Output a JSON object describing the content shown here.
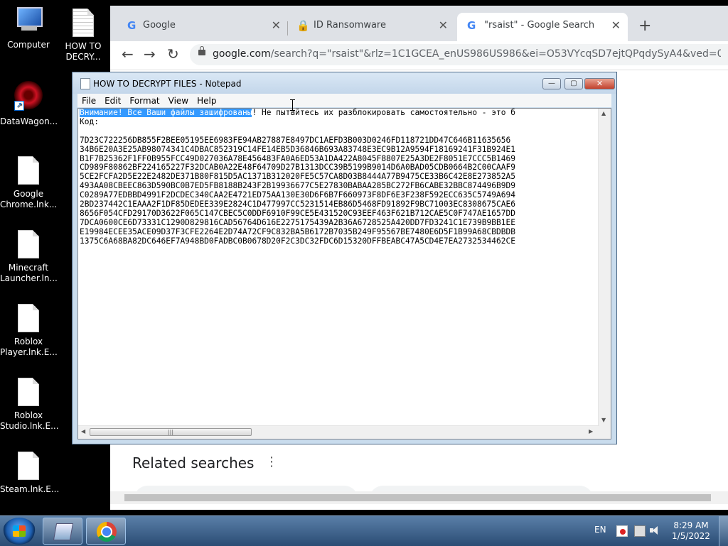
{
  "desktop": {
    "icons": [
      {
        "label": "Computer",
        "icon": "computer-icon"
      },
      {
        "label": "HOW TO\nDECRY...",
        "icon": "text-file-icon"
      },
      {
        "label": "DataWagon...",
        "icon": "datawagon-icon"
      },
      {
        "label": "Google\nChrome.lnk...",
        "icon": "file-icon"
      },
      {
        "label": "Minecraft\nLauncher.ln...",
        "icon": "file-icon"
      },
      {
        "label": "Roblox\nPlayer.lnk.E...",
        "icon": "file-icon"
      },
      {
        "label": "Roblox\nStudio.lnk.E...",
        "icon": "file-icon"
      },
      {
        "label": "Steam.lnk.E...",
        "icon": "file-icon"
      }
    ]
  },
  "browser": {
    "tabs": [
      {
        "title": "Google",
        "icon": "google-icon"
      },
      {
        "title": "ID Ransomware",
        "icon": "google-icon"
      },
      {
        "title": "\"rsaist\" - Google Search",
        "icon": "google-icon",
        "active": true
      }
    ],
    "new_tab": "+",
    "url_host": "google.com",
    "url_path": "/search?q=\"rsaist\"&rlz=1C1GCEA_enUS986US986&ei=O53VYcqSD7ejtQPqdySyA4&ved=0ahUKEwiK...",
    "related_searches": "Related searches"
  },
  "notepad": {
    "title": "HOW TO DECRYPT FILES - Notepad",
    "menu": [
      "File",
      "Edit",
      "Format",
      "View",
      "Help"
    ],
    "controls": {
      "minimize": "—",
      "maximize": "▢",
      "close": "✕"
    },
    "line1_selected": "Внимание! Все Ваши файлы зашифрованы",
    "line1_rest": "! Не пытайтесь их разблокировать самостоятельно - это б",
    "line2": "Код:",
    "code_lines": [
      "7D23C722256DB855F2BEE05195EE6983FE94AB27887E8497DC1AEFD3B003D0246FD118721DD47C646B11635656",
      "34B6E20A3E25AB98074341C4DBAC852319C14FE14EB5D36846B693A83748E3EC9B12A9594F18169241F31B924E1",
      "B1F7B25362F1FF0B955FCC49D027036A78E456483FA0A6ED53A1DA422A8045F8807E25A3DE2F8051E7CCC5B1469",
      "CD989F80862BF224165227F32DCAB0A22E48F64709D27B1313DCC39B5199B9014D6A0BAD05CDB0664B2C00CAAF9",
      "5CE2FCFA2D5E22E2482DE371B80F815D5AC1371B312020FE5C57CA8D03B8444A77B9475CE33B6C42E8E273852A5",
      "493AA08CBEEC863D590BC0B7ED5FB8188B243F2B19936677C5E27830BABAA285BC272FB6CABE32BBC874496B9D9",
      "C0289A77EDBBD4991F2DCDEC340CAA2E4721ED75AA130E30D6F6B7F660973F8DF6E3F238F592ECC635C5749A694",
      "2BD237442C1EAAA2F1DF85DEDEE339E2824C1D477997CC5231514EB86D5468FD91892F9BC71003EC8308675CAE6",
      "8656F054CFD29170D3622F065C147CBEC5C0DDF6910F99CE5E431520C93EEF463F621B712CAE5C0F747AE1657DD",
      "7DCA0600CE6D73331C1290D829816CAD56764D616E2275175439A2B36A6728525A420DD7FD3241C1E739B9BB1EE",
      "E19984ECEE35ACE09D37F3CFE2264E2D74A72CF9C832BA5B6172B7035B249F95567BE7480E6D5F1B99A68CBDBDB",
      "1375C6A68BA82DC646EF7A948BD0FADBC0B0678D20F2C3DC32FDC6D15320DFFBEABC47A5CD4E7EA2732534462CE"
    ]
  },
  "taskbar": {
    "language": "EN",
    "time": "8:29 AM",
    "date": "1/5/2022",
    "buttons": [
      {
        "app": "Notepad",
        "icon": "notepad-icon"
      },
      {
        "app": "Google Chrome",
        "icon": "chrome-icon"
      }
    ]
  }
}
